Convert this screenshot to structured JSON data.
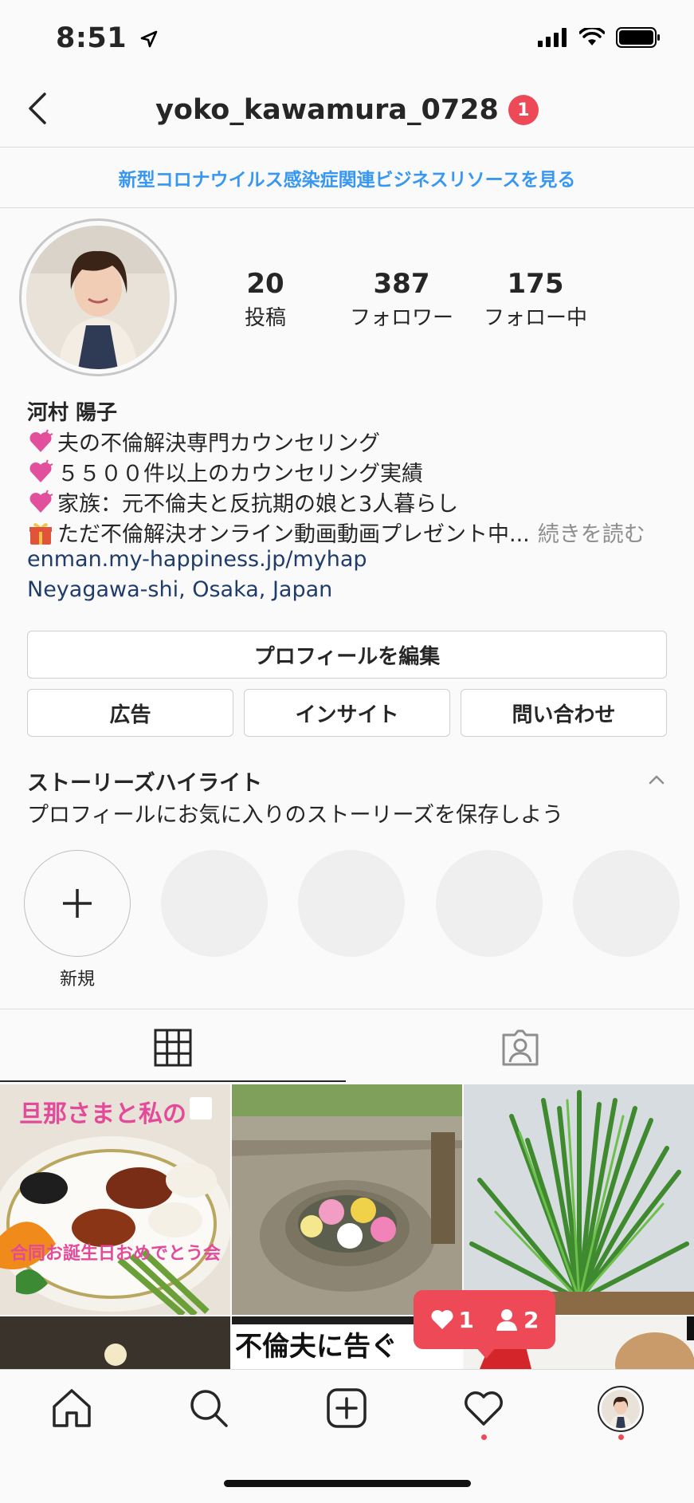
{
  "status_bar": {
    "time": "8:51"
  },
  "header": {
    "username": "yoko_kawamura_0728",
    "notification_count": "1"
  },
  "banner": {
    "text": "新型コロナウイルス感染症関連ビジネスリソースを見る"
  },
  "profile": {
    "stats": [
      {
        "value": "20",
        "label": "投稿"
      },
      {
        "value": "387",
        "label": "フォロワー"
      },
      {
        "value": "175",
        "label": "フォロー中"
      }
    ],
    "name": "河村 陽子",
    "bio": [
      {
        "icon": "pink-heart-icon",
        "text": "夫の不倫解決専門カウンセリング"
      },
      {
        "icon": "pink-heart-icon",
        "text": "５５００件以上のカウンセリング実績"
      },
      {
        "icon": "pink-heart-icon",
        "text": "家族：元不倫夫と反抗期の娘と3人暮らし"
      },
      {
        "icon": "gift-icon",
        "text": "ただ不倫解決オンライン動画動画プレゼント中...",
        "more": "続きを読む"
      }
    ],
    "website": "enman.my-happiness.jp/myhap",
    "location": "Neyagawa-shi, Osaka, Japan"
  },
  "buttons": {
    "edit_profile": "プロフィールを編集",
    "ads": "広告",
    "insights": "インサイト",
    "contact": "問い合わせ"
  },
  "highlights": {
    "title": "ストーリーズハイライト",
    "subtitle": "プロフィールにお気に入りのストーリーズを保存しよう",
    "new_label": "新規"
  },
  "posts": {
    "post1_top_text": "旦那さまと私の",
    "post1_bottom_text": "合同お誕生日おめでとう会",
    "post5_text": "不倫夫に告ぐ"
  },
  "activity": {
    "likes": "1",
    "follows": "2"
  },
  "colors": {
    "accent_blue": "#3897f0",
    "notification_red": "#ed4956",
    "link_blue": "#1f3c6b"
  }
}
